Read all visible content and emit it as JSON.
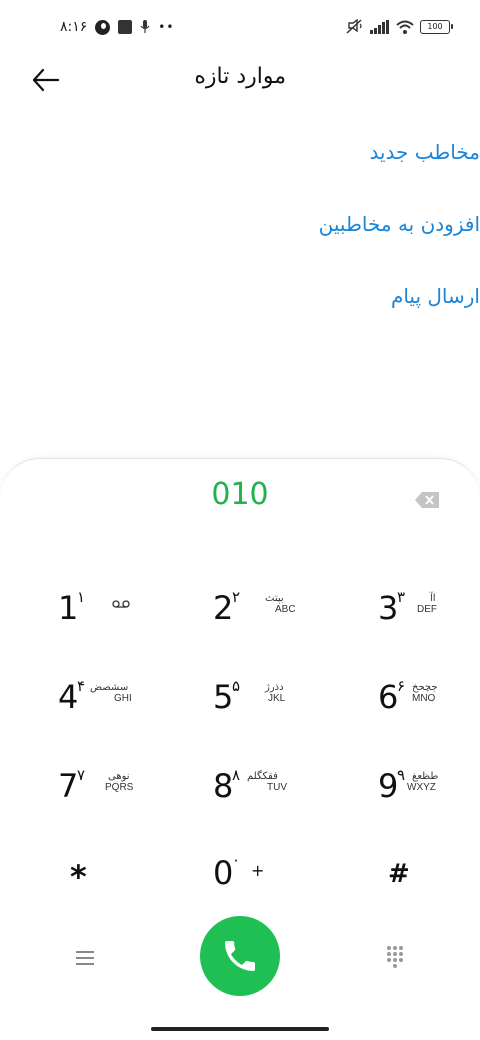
{
  "status_bar": {
    "time": "۸:۱۶",
    "dots": "••",
    "battery": "100"
  },
  "header": {
    "title": "موارد تازه"
  },
  "actions": [
    {
      "label": "مخاطب جدید"
    },
    {
      "label": "افزودن به مخاطبین"
    },
    {
      "label": "ارسال پیام"
    }
  ],
  "dialer": {
    "number": "010",
    "keys": [
      {
        "digit": "1",
        "fa": "۱",
        "top": "",
        "bottom": ""
      },
      {
        "digit": "2",
        "fa": "۲",
        "top": "بپتث",
        "bottom": "ABC"
      },
      {
        "digit": "3",
        "fa": "۳",
        "top": "اآ",
        "bottom": "DEF"
      },
      {
        "digit": "4",
        "fa": "۴",
        "top": "سشصض",
        "bottom": "GHI"
      },
      {
        "digit": "5",
        "fa": "۵",
        "top": "دذرژ",
        "bottom": "JKL"
      },
      {
        "digit": "6",
        "fa": "۶",
        "top": "جچحخ",
        "bottom": "MNO"
      },
      {
        "digit": "7",
        "fa": "۷",
        "top": "نوهی",
        "bottom": "PQRS"
      },
      {
        "digit": "8",
        "fa": "۸",
        "top": "فقکگلم",
        "bottom": "TUV"
      },
      {
        "digit": "9",
        "fa": "۹",
        "top": "طظعغ",
        "bottom": "WXYZ"
      },
      {
        "symbol": "*"
      },
      {
        "digit": "0",
        "fa": "۰",
        "plus": "+"
      },
      {
        "symbol": "#"
      }
    ]
  },
  "colors": {
    "accent_link": "#1a86d9",
    "number_green": "#1fb34a",
    "call_green": "#1fbf54"
  },
  "icons": {
    "back": "arrow-left-icon",
    "backspace": "backspace-icon",
    "voicemail": "voicemail-icon",
    "call": "phone-icon",
    "menu": "menu-icon",
    "dialpad": "dialpad-icon"
  }
}
